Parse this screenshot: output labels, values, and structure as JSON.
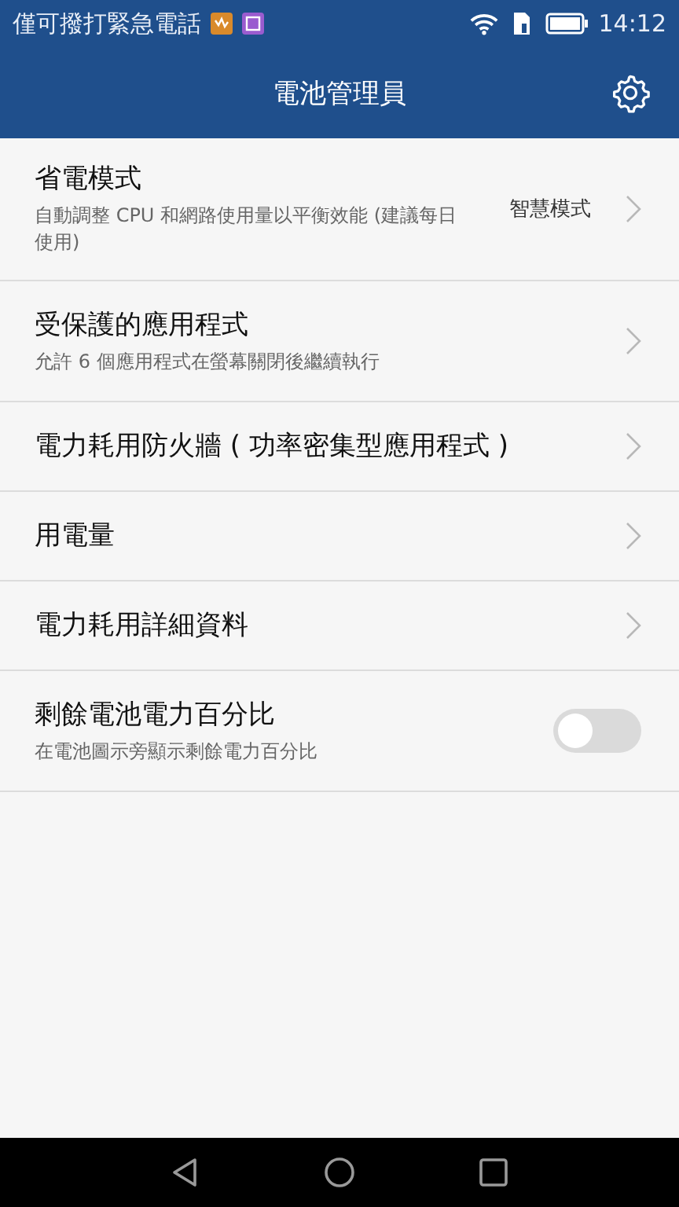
{
  "status_bar": {
    "notice": "僅可撥打緊急電話",
    "time": "14:12"
  },
  "app_bar": {
    "title": "電池管理員"
  },
  "settings": [
    {
      "kind": "nav",
      "title": "省電模式",
      "subtitle": "自動調整 CPU 和網路使用量以平衡效能 (建議每日使用)",
      "value": "智慧模式"
    },
    {
      "kind": "nav",
      "title": "受保護的應用程式",
      "subtitle": "允許 6 個應用程式在螢幕關閉後繼續執行"
    },
    {
      "kind": "nav",
      "title": "電力耗用防火牆 ( 功率密集型應用程式 )"
    },
    {
      "kind": "nav",
      "title": "用電量"
    },
    {
      "kind": "nav",
      "title": "電力耗用詳細資料"
    },
    {
      "kind": "toggle",
      "title": "剩餘電池電力百分比",
      "subtitle": "在電池圖示旁顯示剩餘電力百分比",
      "on": false
    }
  ]
}
